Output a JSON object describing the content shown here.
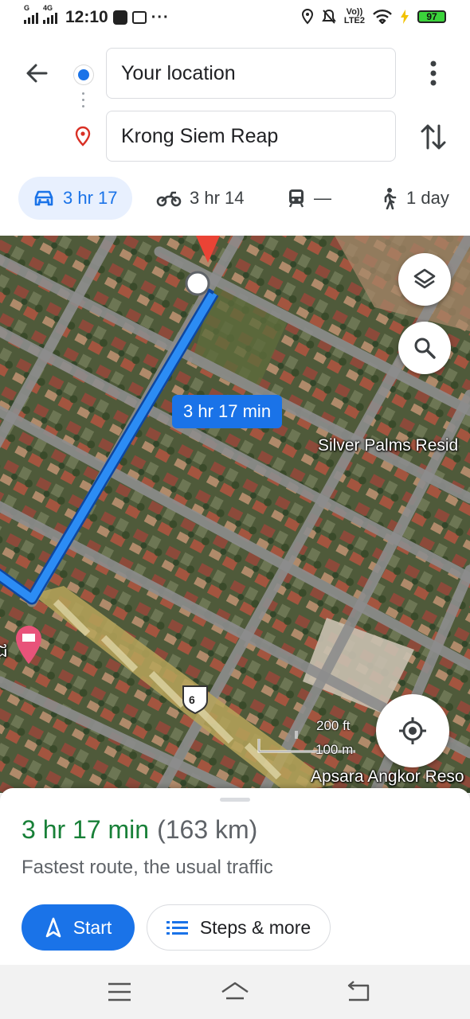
{
  "status_bar": {
    "time": "12:10",
    "network_1": "G",
    "network_2": "4G",
    "volte": "Vo))\nLTE2",
    "battery": "97"
  },
  "directions": {
    "from": "Your location",
    "to": "Krong Siem Reap"
  },
  "modes": [
    {
      "name": "drive",
      "label": "3 hr 17",
      "active": true
    },
    {
      "name": "motorcycle",
      "label": "3 hr 14",
      "active": false
    },
    {
      "name": "transit",
      "label": "—",
      "active": false
    },
    {
      "name": "walk",
      "label": "1 day",
      "active": false
    }
  ],
  "map": {
    "route_label": "3 hr 17 min",
    "place_labels": [
      "Silver Palms Resid",
      "Apsara Angkor Reso"
    ],
    "shield": "6",
    "partial_label": "ជ",
    "scale_ft": "200 ft",
    "scale_m": "100 m"
  },
  "summary": {
    "eta": "3 hr 17 min",
    "distance": "(163 km)",
    "description": "Fastest route, the usual traffic",
    "start_label": "Start",
    "steps_label": "Steps & more"
  },
  "colors": {
    "accent": "#1a73e8",
    "eta_green": "#188038",
    "route_blue": "#1a73e8",
    "pin_red": "#ea4335"
  },
  "icons": [
    "arrow-back-icon",
    "origin-dot-icon",
    "destination-pin-icon",
    "more-vert-icon",
    "swap-icon",
    "car-icon",
    "motorcycle-icon",
    "train-icon",
    "walk-icon",
    "layers-icon",
    "search-icon",
    "my-location-icon",
    "navigation-arrow-icon",
    "list-icon",
    "hotel-icon"
  ]
}
